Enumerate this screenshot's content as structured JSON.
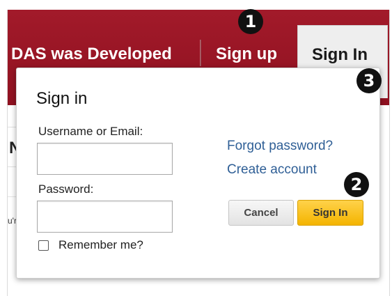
{
  "nav": {
    "about_link": "DAS was Developed",
    "signup_link": "Sign up",
    "signin_tab": "Sign In"
  },
  "background": {
    "heading_fragment": "Ne",
    "text_fragment": "u'r"
  },
  "signin_popup": {
    "title": "Sign in",
    "username_label": "Username or Email:",
    "username_value": "",
    "password_label": "Password:",
    "password_value": "",
    "remember_label": "Remember me?",
    "remember_checked": false,
    "forgot_password_link": "Forgot password?",
    "create_account_link": "Create account",
    "cancel_button": "Cancel",
    "signin_button": "Sign In"
  },
  "markers": {
    "one": "1",
    "two": "2",
    "three": "3"
  },
  "colors": {
    "navbar": "#9b1626",
    "link": "#2f5f96",
    "primary_button": "#f4b400"
  }
}
